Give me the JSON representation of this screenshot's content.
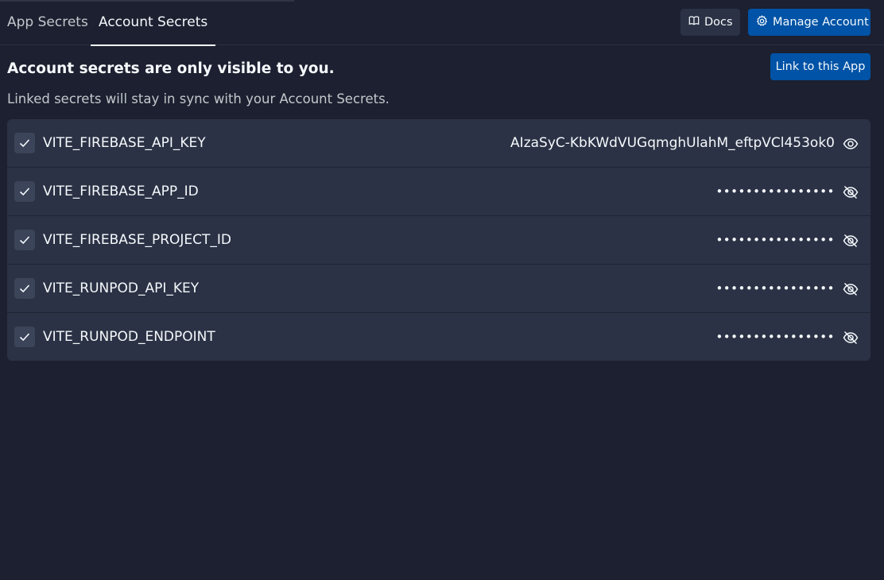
{
  "tabs": [
    {
      "label": "App Secrets",
      "active": false
    },
    {
      "label": "Account Secrets",
      "active": true
    }
  ],
  "header": {
    "docs_label": "Docs",
    "manage_label": "Manage Account"
  },
  "main": {
    "heading": "Account secrets are only visible to you.",
    "subtext": "Linked secrets will stay in sync with your Account Secrets.",
    "link_button": "Link to this App"
  },
  "secrets": [
    {
      "key": "VITE_FIREBASE_API_KEY",
      "value": "AIzaSyC-KbKWdVUGqmghUlahM_eftpVCl453ok0",
      "visible": true,
      "checked": true
    },
    {
      "key": "VITE_FIREBASE_APP_ID",
      "value": "••••••••••••••••",
      "visible": false,
      "checked": true
    },
    {
      "key": "VITE_FIREBASE_PROJECT_ID",
      "value": "••••••••••••••••",
      "visible": false,
      "checked": true
    },
    {
      "key": "VITE_RUNPOD_API_KEY",
      "value": "••••••••••••••••",
      "visible": false,
      "checked": true
    },
    {
      "key": "VITE_RUNPOD_ENDPOINT",
      "value": "••••••••••••••••",
      "visible": false,
      "checked": true
    }
  ],
  "colors": {
    "background": "#1c2030",
    "panel": "#2b3245",
    "primary": "#0053a6",
    "text": "#f5f9fc",
    "muted": "#c2c8cc"
  },
  "icons": {
    "docs": "book-icon",
    "manage": "gear-icon",
    "check": "checkmark-icon",
    "shown": "eye-icon",
    "hidden": "eye-slash-icon"
  }
}
